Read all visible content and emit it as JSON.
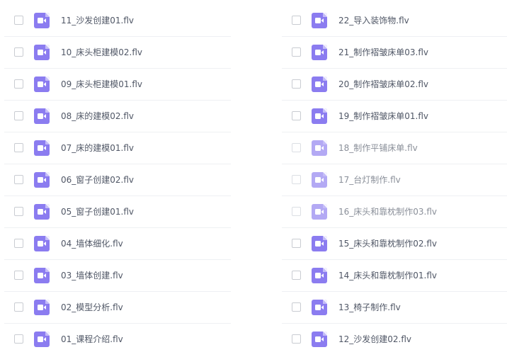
{
  "files": {
    "left": [
      {
        "name": "11_沙发创建01.flv"
      },
      {
        "name": "10_床头柜建模02.flv"
      },
      {
        "name": "09_床头柜建模01.flv"
      },
      {
        "name": "08_床的建模02.flv"
      },
      {
        "name": "07_床的建模01.flv"
      },
      {
        "name": "06_窗子创建02.flv"
      },
      {
        "name": "05_窗子创建01.flv"
      },
      {
        "name": "04_墙体细化.flv"
      },
      {
        "name": "03_墙体创建.flv"
      },
      {
        "name": "02_模型分析.flv"
      },
      {
        "name": "01_课程介绍.flv"
      }
    ],
    "right": [
      {
        "name": "22_导入装饰物.flv"
      },
      {
        "name": "21_制作褶皱床单03.flv"
      },
      {
        "name": "20_制作褶皱床单02.flv"
      },
      {
        "name": "19_制作褶皱床单01.flv"
      },
      {
        "name": "18_制作平铺床单.flv"
      },
      {
        "name": "17_台灯制作.flv"
      },
      {
        "name": "16_床头和靠枕制作03.flv"
      },
      {
        "name": "15_床头和靠枕制作02.flv"
      },
      {
        "name": "14_床头和靠枕制作01.flv"
      },
      {
        "name": "13_椅子制作.flv"
      },
      {
        "name": "12_沙发创建02.flv"
      }
    ]
  },
  "icon": {
    "semantic": "video-file-icon",
    "color": "#8b7cf0"
  }
}
